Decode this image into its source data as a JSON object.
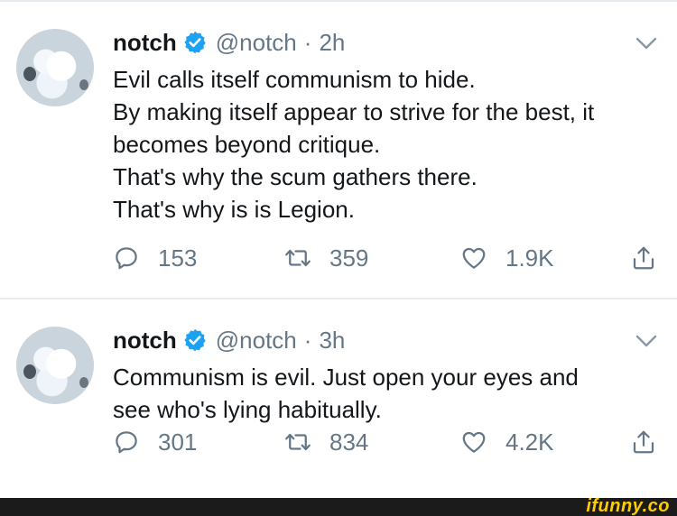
{
  "tweets": [
    {
      "name": "notch",
      "handle": "@notch",
      "separator": "·",
      "time": "2h",
      "lines": [
        "Evil calls itself communism to hide.",
        "By making itself appear to strive for the best, it",
        "becomes beyond critique.",
        "That's why the scum gathers there.",
        "That's why is is Legion."
      ],
      "replies": "153",
      "retweets": "359",
      "likes": "1.9K"
    },
    {
      "name": "notch",
      "handle": "@notch",
      "separator": "·",
      "time": "3h",
      "lines": [
        "Communism is evil. Just open your eyes and",
        "see who's lying habitually."
      ],
      "replies": "301",
      "retweets": "834",
      "likes": "4.2K"
    }
  ],
  "icons": {
    "verified": "verified-badge-icon",
    "caret": "chevron-down-icon",
    "reply": "reply-icon",
    "retweet": "retweet-icon",
    "like": "heart-icon",
    "share": "share-icon"
  },
  "colors": {
    "verified": "#1da1f2",
    "secondary_text": "#657786",
    "primary_text": "#14171a",
    "divider": "#e6ecf0",
    "watermark": "#ffcc00"
  },
  "watermark": "ifunny.co"
}
